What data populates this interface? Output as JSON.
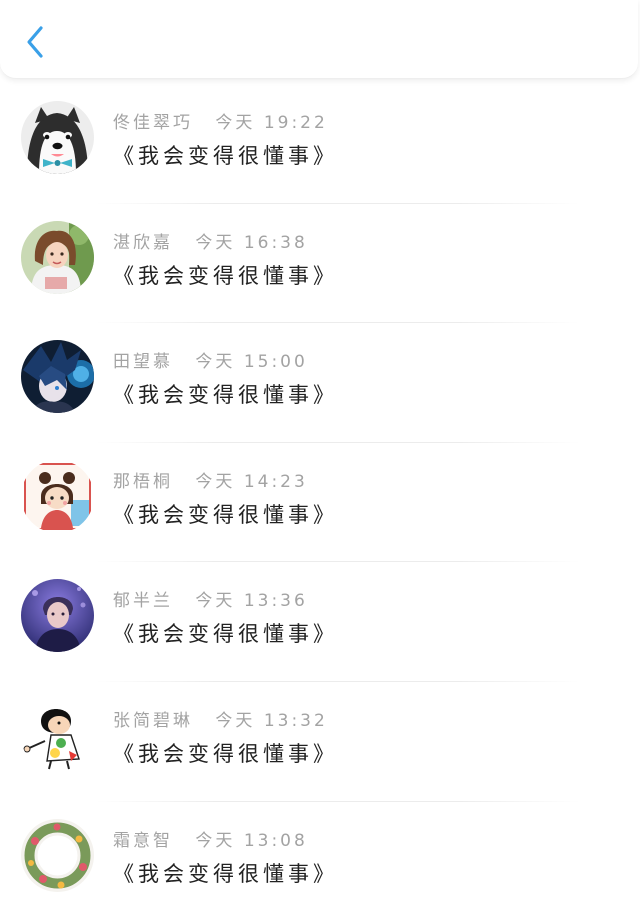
{
  "nav": {
    "back_icon": "chevron-left-icon",
    "accent_color": "#3aa0e8"
  },
  "messages": [
    {
      "name": "佟佳翠巧",
      "day": "今天",
      "time": "19:22",
      "text": "《我会变得很懂事》",
      "avatar": "husky-dog-avatar"
    },
    {
      "name": "湛欣嘉",
      "day": "今天",
      "time": "16:38",
      "text": "《我会变得很懂事》",
      "avatar": "girl-photo-avatar"
    },
    {
      "name": "田望慕",
      "day": "今天",
      "time": "15:00",
      "text": "《我会变得很懂事》",
      "avatar": "anime-boy-avatar"
    },
    {
      "name": "那梧桐",
      "day": "今天",
      "time": "14:23",
      "text": "《我会变得很懂事》",
      "avatar": "cartoon-girl-avatar"
    },
    {
      "name": "郁半兰",
      "day": "今天",
      "time": "13:36",
      "text": "《我会变得很懂事》",
      "avatar": "purple-portrait-avatar"
    },
    {
      "name": "张简碧琳",
      "day": "今天",
      "time": "13:32",
      "text": "《我会变得很懂事》",
      "avatar": "shinchan-avatar"
    },
    {
      "name": "霜意智",
      "day": "今天",
      "time": "13:08",
      "text": "《我会变得很懂事》",
      "avatar": "flower-wreath-avatar"
    }
  ]
}
